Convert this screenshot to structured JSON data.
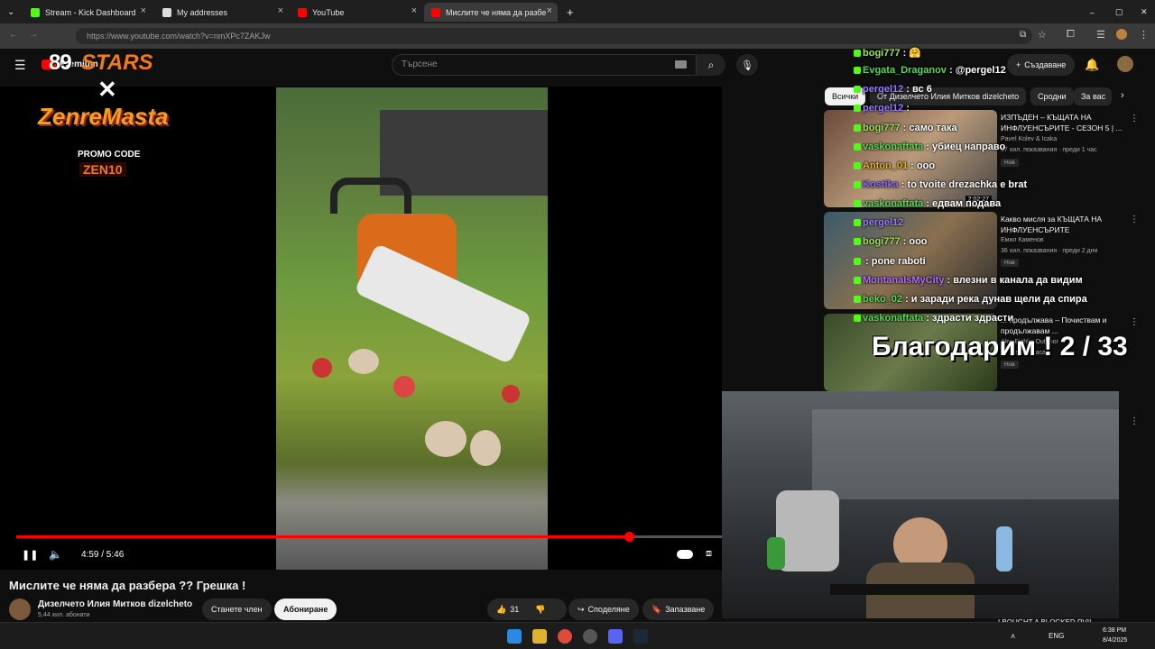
{
  "browser": {
    "tabs": [
      {
        "label": "Stream - Kick Dashboard",
        "color": "#53fc18"
      },
      {
        "label": "My addresses",
        "color": "#ffffff"
      },
      {
        "label": "YouTube",
        "color": "#ff0000"
      },
      {
        "label": "Мислите че няма да разбе",
        "color": "#ff0000",
        "active": true
      }
    ],
    "url": "https://www.youtube.com/watch?v=nmXPc7ZAKJw"
  },
  "youtube": {
    "logo": "Premium",
    "search_placeholder": "Търсене",
    "create_label": "Създаване",
    "chips": [
      "Всички",
      "От Дизелчето Илия Митков dizelcheto",
      "Сродни",
      "За вас"
    ],
    "player": {
      "time": "4:59 / 5:46",
      "progress": 0.868
    },
    "video_title": "Мислите че няма да разбера ?? Грешка !",
    "channel_name": "Дизелчето Илия Митков dizelcheto",
    "subscribers": "5,44 хил. абонати",
    "join_label": "Станете член",
    "subscribe_label": "Абониране",
    "likes": "31",
    "share_label": "Споделяне",
    "save_label": "Запазване",
    "recommendations": [
      {
        "title": "ИЗПЪДЕН – КЪЩАТА НА ИНФЛУЕНСЪРИТЕ - СЕЗОН 5 | ...",
        "channel": "Pavel Kolev & Icaka",
        "meta": "37 хил. показвания · преди 1 час",
        "badge": "Нов",
        "duration": "2:02:27"
      },
      {
        "title": "Какво мисля за КЪЩАТА НА ИНФЛУЕНСЪРИТЕ",
        "channel": "Емил Каменов",
        "meta": "36 хил. показвания · преди 2 дни",
        "badge": "Нов"
      },
      {
        "title": "... продължава – Почиствам и продължавам ...",
        "channel": "Alex Bishko Outdoor",
        "meta": "... преди 4 часа",
        "badge": "Нов"
      }
    ],
    "bottom_peek": "I BOUGHT A BLOCKED RV!!"
  },
  "chat": [
    {
      "user": "bogi777",
      "msg": ": 🤗",
      "color": "#a0e060"
    },
    {
      "user": "Evgata_Draganov",
      "msg": ": @pergel12",
      "color": "#5ad65a"
    },
    {
      "user": "pergel12",
      "msg": ": вс 6",
      "color": "#9a7bff"
    },
    {
      "user": "pergel12",
      "msg": ":",
      "color": "#9a7bff"
    },
    {
      "user": "bogi777",
      "msg": ": само така",
      "color": "#a0e060"
    },
    {
      "user": "vaskonaftata",
      "msg": ": убиец направо",
      "color": "#5ad65a"
    },
    {
      "user": "Anton_01",
      "msg": ": ооо",
      "color": "#e0b030"
    },
    {
      "user": "Kostika",
      "msg": ": to tvoite drezachka e brat",
      "color": "#8a6cff"
    },
    {
      "user": "vaskonaftata",
      "msg": ": едвам подава",
      "color": "#5ad65a"
    },
    {
      "user": "pergel12",
      "msg": "",
      "color": "#9a7bff"
    },
    {
      "user": "bogi777",
      "msg": ": ооо",
      "color": "#a0e060"
    },
    {
      "user": "",
      "msg": ": pone raboti",
      "color": "#9a7bff"
    },
    {
      "user": "MontanaIsMyCity",
      "msg": ": влезни в канала да видим",
      "color": "#b070ff"
    },
    {
      "user": "beko_02",
      "msg": ": и заради река дунав щели да спира",
      "color": "#5ad65a"
    },
    {
      "user": "vaskonaftata",
      "msg": ": здрасти здрасти",
      "color": "#5ad65a"
    }
  ],
  "overlay": {
    "logo_top": "STARS",
    "logo_x": "✕",
    "logo_brand": "ZenreMasta",
    "promo_label": "PROMO CODE",
    "promo_code": "ZEN10",
    "thanks": "Благодарим ! 2 / 33"
  },
  "taskbar": {
    "lang": "ENG",
    "time": "6:38 PM",
    "date": "8/4/2025"
  }
}
